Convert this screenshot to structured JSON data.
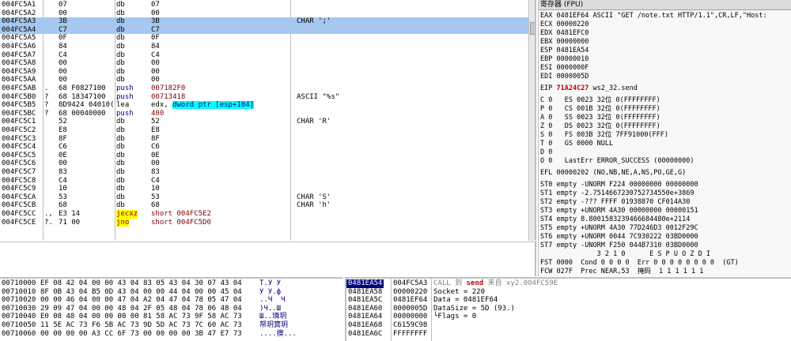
{
  "disasm": [
    {
      "addr": "004FC5A1",
      "mark": "",
      "hex": "07",
      "op": "db",
      "arg": "07",
      "cmt": ""
    },
    {
      "addr": "004FC5A2",
      "mark": "",
      "hex": "00",
      "op": "db",
      "arg": "00",
      "cmt": ""
    },
    {
      "addr": "004FC5A3",
      "mark": "",
      "hex": "3B",
      "op": "db",
      "arg": "3B",
      "cmt": "CHAR ';'",
      "sel": true
    },
    {
      "addr": "004FC5A4",
      "mark": "",
      "hex": "C7",
      "op": "db",
      "arg": "C7",
      "cmt": "",
      "sel": true
    },
    {
      "addr": "004FC5A5",
      "mark": "",
      "hex": "0F",
      "op": "db",
      "arg": "0F",
      "cmt": ""
    },
    {
      "addr": "004FC5A6",
      "mark": "",
      "hex": "84",
      "op": "db",
      "arg": "84",
      "cmt": ""
    },
    {
      "addr": "004FC5A7",
      "mark": "",
      "hex": "C4",
      "op": "db",
      "arg": "C4",
      "cmt": ""
    },
    {
      "addr": "004FC5A8",
      "mark": "",
      "hex": "00",
      "op": "db",
      "arg": "00",
      "cmt": ""
    },
    {
      "addr": "004FC5A9",
      "mark": "",
      "hex": "00",
      "op": "db",
      "arg": "00",
      "cmt": ""
    },
    {
      "addr": "004FC5AA",
      "mark": "",
      "hex": "00",
      "op": "db",
      "arg": "00",
      "cmt": ""
    },
    {
      "addr": "004FC5AB",
      "mark": ".",
      "hex": "68 F0827100",
      "op": "push",
      "arg": "007182F0",
      "cmt": "",
      "kind": "push"
    },
    {
      "addr": "004FC5B0",
      "mark": "?",
      "hex": "68 18347100",
      "op": "push",
      "arg": "00713418",
      "cmt": "ASCII \"%s\"",
      "kind": "push"
    },
    {
      "addr": "004FC5B5",
      "mark": "?",
      "hex": "8D9424 04010(",
      "op": "lea",
      "arg_a": "edx, ",
      "arg_b": "dword ptr [esp+104]",
      "cmt": "",
      "kind": "lea"
    },
    {
      "addr": "004FC5BC",
      "mark": "?",
      "hex": "68 00040000",
      "op": "push",
      "arg": "400",
      "cmt": "",
      "kind": "push400"
    },
    {
      "addr": "004FC5C1",
      "mark": "",
      "hex": "52",
      "op": "db",
      "arg": "52",
      "cmt": "CHAR 'R'"
    },
    {
      "addr": "004FC5C2",
      "mark": "",
      "hex": "E8",
      "op": "db",
      "arg": "E8",
      "cmt": ""
    },
    {
      "addr": "004FC5C3",
      "mark": "",
      "hex": "8F",
      "op": "db",
      "arg": "8F",
      "cmt": ""
    },
    {
      "addr": "004FC5C4",
      "mark": "",
      "hex": "C6",
      "op": "db",
      "arg": "C6",
      "cmt": ""
    },
    {
      "addr": "004FC5C5",
      "mark": "",
      "hex": "0E",
      "op": "db",
      "arg": "0E",
      "cmt": ""
    },
    {
      "addr": "004FC5C6",
      "mark": "",
      "hex": "00",
      "op": "db",
      "arg": "00",
      "cmt": ""
    },
    {
      "addr": "004FC5C7",
      "mark": "",
      "hex": "83",
      "op": "db",
      "arg": "83",
      "cmt": ""
    },
    {
      "addr": "004FC5C8",
      "mark": "",
      "hex": "C4",
      "op": "db",
      "arg": "C4",
      "cmt": ""
    },
    {
      "addr": "004FC5C9",
      "mark": "",
      "hex": "10",
      "op": "db",
      "arg": "10",
      "cmt": ""
    },
    {
      "addr": "004FC5CA",
      "mark": "",
      "hex": "53",
      "op": "db",
      "arg": "53",
      "cmt": "CHAR 'S'"
    },
    {
      "addr": "004FC5CB",
      "mark": "",
      "hex": "68",
      "op": "db",
      "arg": "68",
      "cmt": "CHAR 'h'"
    },
    {
      "addr": "004FC5CC",
      "mark": ".,",
      "hex": "E3 14",
      "op": "jecxz",
      "arg": "short 004FC5E2",
      "cmt": "",
      "kind": "jmp"
    },
    {
      "addr": "004FC5CE",
      "mark": "?.",
      "hex": "71 00",
      "op": "jno",
      "arg": "short 004FC5D0",
      "cmt": "",
      "kind": "jmp"
    }
  ],
  "registers": {
    "title": "寄存器 (FPU)",
    "lines": [
      "EAX 0481EF64 ASCII \"GET /note.txt HTTP/1.1\",CR,LF,\"Host:",
      "ECX 00000220",
      "EDX 0481EFC0",
      "EBX 00000000",
      "ESP 0481EA54",
      "EBP 00000010",
      "ESI 0000000F",
      "EDI 0000005D"
    ],
    "eip_label": "EIP ",
    "eip_value": "71A24C27",
    "eip_desc": " ws2_32.send",
    "flags": [
      "C 0   ES 0023 32位 0(FFFFFFFF)",
      "P 0   CS 001B 32位 0(FFFFFFFF)",
      "A 0   SS 0023 32位 0(FFFFFFFF)",
      "Z 0   DS 0023 32位 0(FFFFFFFF)",
      "S 0   FS 003B 32位 7FF91000(FFF)",
      "T 0   GS 0000 NULL",
      "D 0",
      "O 0   LastErr ERROR_SUCCESS (00000000)"
    ],
    "efl": "EFL 00000202 (NO,NB,NE,A,NS,PO,GE,G)",
    "fpu": [
      "ST0 empty -UNORM F224 00000000 00000000",
      "ST1 empty -2.7514667230752734550e+3869",
      "ST2 empty -??? FFFF 01938870 CF014A30",
      "ST3 empty +UNORM 4A30 00000000 00000151",
      "ST4 empty 8.8001583239466684480e+2114",
      "ST5 empty +UNORM 4A30 77D246D3 0012F29C",
      "ST6 empty +UNORM 0044 7C930222 03BD0000",
      "ST7 empty -UNORM F250 044B7310 03BD0000"
    ],
    "fpu_bits": "              3 2 1 0      E S P U O Z D I",
    "fst": "FST 0000  Cond 0 0 0 0  Err 0 0 0 0 0 0 0 0  (GT)",
    "fcw": "FCW 027F  Prec NEAR,53  掩码  1 1 1 1 1 1"
  },
  "dump": [
    {
      "addr": "00710000",
      "hex": "EF 08 42 04 00 00 43 04 83 05 43 04 30 07 43 04",
      "asc": "T.У У"
    },
    {
      "addr": "00710010",
      "hex": "8F 0B 43 04 B5 0D 43 04 00 00 44 04 00 00 45 04",
      "asc": "У У.ф"
    },
    {
      "addr": "00710020",
      "hex": "00 00 46 04 00 00 47 04 A2 04 47 04 78 05 47 04",
      "asc": "..Ч  Ч"
    },
    {
      "addr": "00710030",
      "hex": "29 09 47 04 00 00 48 04 2F 05 48 04 78 06 48 04",
      "asc": ")Ч..Ш"
    },
    {
      "addr": "00710040",
      "hex": "E0 08 48 04 00 00 00 00 81 58 AC 73 9F 58 AC 73",
      "asc": "Ш..璘玥"
    },
    {
      "addr": "00710050",
      "hex": "11 5E AC 73 F6 5B AC 73 9D 5D AC 73 7C 60 AC 73",
      "asc": "帑玥寶玥"
    },
    {
      "addr": "00710060",
      "hex": "00 00 00 00 A3 CC 6F 73 00 00 00 00 3B 47 E7 73",
      "asc": "....擙..."
    }
  ],
  "stack": [
    {
      "addr": "0481EA54",
      "val": "004FC5A3",
      "cmt_a": "CALL 到 ",
      "cmt_send": "send",
      "cmt_b": " 来自 xy2.004FC59E",
      "sel": true
    },
    {
      "addr": "0481EA58",
      "val": "00000220",
      "cmt": "Socket = 220"
    },
    {
      "addr": "0481EA5C",
      "val": "0481EF64",
      "cmt": "Data = 0481EF64"
    },
    {
      "addr": "0481EA60",
      "val": "0000005D",
      "cmt": "DataSize = 5D (93.)"
    },
    {
      "addr": "0481EA64",
      "val": "00000000",
      "cmt": "└Flags = 0"
    },
    {
      "addr": "0481EA68",
      "val": "C6159C98",
      "cmt": ""
    },
    {
      "addr": "0481EA6C",
      "val": "FFFFFFFF",
      "cmt": ""
    }
  ]
}
